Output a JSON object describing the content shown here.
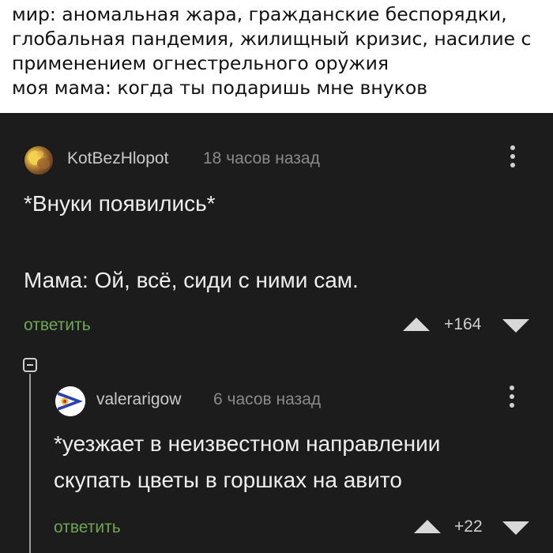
{
  "caption": {
    "lines": [
      "мир: аномальная жара, гражданские беспорядки,",
      "глобальная пандемия, жилищный кризис, насилие с",
      "применением огнестрельного оружия",
      "моя мама: когда ты подаришь мне внуков"
    ]
  },
  "comments": [
    {
      "username": "KotBezHlopot",
      "time": "18 часов назад",
      "text_lines": [
        "*Внуки появились*",
        "",
        "Мама: Ой, всё, сиди с ними сам."
      ],
      "reply_label": "ответить",
      "rating": "+164",
      "avatar_icon": "user-avatar-icon",
      "menu_icon": "more-vertical-icon"
    },
    {
      "username": "valerarigow",
      "time": "6 часов назад",
      "text_lines": [
        "*уезжает в неизвестном направлении",
        "скупать цветы в горшках на авито"
      ],
      "reply_label": "ответить",
      "rating": "+22",
      "avatar_icon": "user-avatar-icon",
      "menu_icon": "more-vertical-icon"
    }
  ],
  "thread": {
    "collapse_icon": "collapse-minus-icon"
  },
  "colors": {
    "background": "#1c1c1c",
    "caption_background": "#ffffff",
    "reply_link": "#6fa653",
    "username": "#c9c9c9",
    "timestamp": "#8a8a8a",
    "comment_text": "#eeeeee"
  }
}
